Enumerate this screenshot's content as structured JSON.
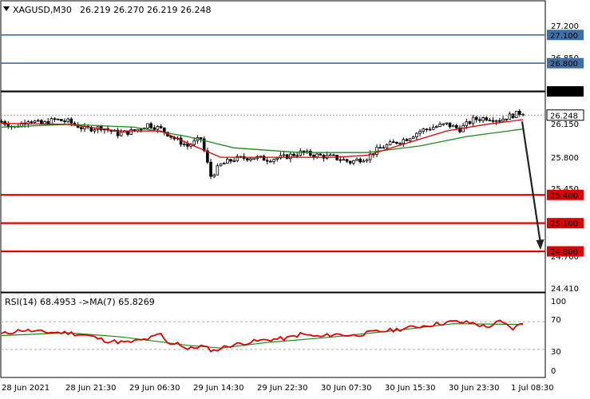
{
  "header": {
    "symbol": "XAGUSD,M30",
    "ohlc": "26.219 26.270 26.219 26.248"
  },
  "price_axis": {
    "ticks": [
      "27.200",
      "26.850",
      "26.150",
      "25.800",
      "25.450",
      "24.700",
      "24.410"
    ],
    "current_price": "26.248"
  },
  "levels": [
    {
      "label": "27.100",
      "value": 27.1,
      "color": "#3d6fa8",
      "box": "#3d6fa8",
      "text": "#ffffff",
      "width": 1.6
    },
    {
      "label": "26.800",
      "value": 26.8,
      "color": "#3d6fa8",
      "box": "#3d6fa8",
      "text": "#ffffff",
      "width": 1.6
    },
    {
      "label": "26.500",
      "value": 26.5,
      "color": "#000000",
      "box": "#000000",
      "text": "#ffffff",
      "width": 2.2
    },
    {
      "label": "25.400",
      "value": 25.4,
      "color": "#e00000",
      "box": "#e00000",
      "text": "#ffffff",
      "width": 2.2
    },
    {
      "label": "25.100",
      "value": 25.1,
      "color": "#e00000",
      "box": "#e00000",
      "text": "#ffffff",
      "width": 2.2
    },
    {
      "label": "24.800",
      "value": 24.8,
      "color": "#e00000",
      "box": "#e00000",
      "text": "#ffffff",
      "width": 2.2
    }
  ],
  "rsi": {
    "label": "RSI(14) 68.4953 ->MA(7) 65.8269",
    "ticks": [
      "100",
      "70",
      "30",
      "0"
    ]
  },
  "time_axis": {
    "labels": [
      "28 Jun 2021",
      "28 Jun 21:30",
      "29 Jun 06:30",
      "29 Jun 14:30",
      "29 Jun 22:30",
      "30 Jun 07:30",
      "30 Jun 15:30",
      "30 Jun 23:30",
      "1 Jul 08:30"
    ]
  },
  "colors": {
    "ma_fast": "#e00000",
    "ma_slow": "#1a8a1a",
    "rsi_line": "#e00000",
    "rsi_ma": "#1a8a1a",
    "arrow": "#222222"
  },
  "chart_data": {
    "type": "candlestick",
    "price_range": [
      24.41,
      27.3
    ],
    "close_path": [
      [
        0,
        26.18
      ],
      [
        4,
        26.12
      ],
      [
        8,
        26.2
      ],
      [
        12,
        26.15
      ],
      [
        16,
        26.2
      ],
      [
        20,
        26.18
      ],
      [
        25,
        26.1
      ],
      [
        30,
        26.12
      ],
      [
        35,
        26.05
      ],
      [
        40,
        26.08
      ],
      [
        44,
        26.15
      ],
      [
        48,
        26.1
      ],
      [
        52,
        26.0
      ],
      [
        56,
        25.92
      ],
      [
        60,
        26.0
      ],
      [
        63,
        25.6
      ],
      [
        66,
        25.72
      ],
      [
        70,
        25.78
      ],
      [
        75,
        25.8
      ],
      [
        80,
        25.78
      ],
      [
        85,
        25.8
      ],
      [
        90,
        25.85
      ],
      [
        95,
        25.82
      ],
      [
        100,
        25.8
      ],
      [
        105,
        25.75
      ],
      [
        110,
        25.8
      ],
      [
        114,
        25.9
      ],
      [
        118,
        25.95
      ],
      [
        122,
        26.0
      ],
      [
        126,
        26.08
      ],
      [
        130,
        26.12
      ],
      [
        134,
        26.15
      ],
      [
        138,
        26.1
      ],
      [
        142,
        26.2
      ],
      [
        146,
        26.22
      ],
      [
        150,
        26.2
      ],
      [
        154,
        26.25
      ],
      [
        157,
        26.28
      ]
    ],
    "ma_fast": [
      [
        0,
        26.16
      ],
      [
        20,
        26.15
      ],
      [
        35,
        26.08
      ],
      [
        48,
        26.08
      ],
      [
        56,
        25.95
      ],
      [
        66,
        25.8
      ],
      [
        80,
        25.8
      ],
      [
        100,
        25.8
      ],
      [
        110,
        25.82
      ],
      [
        122,
        25.95
      ],
      [
        134,
        26.08
      ],
      [
        146,
        26.15
      ],
      [
        157,
        26.2
      ]
    ],
    "ma_slow": [
      [
        0,
        26.12
      ],
      [
        20,
        26.15
      ],
      [
        40,
        26.12
      ],
      [
        56,
        26.02
      ],
      [
        70,
        25.9
      ],
      [
        90,
        25.85
      ],
      [
        110,
        25.85
      ],
      [
        126,
        25.92
      ],
      [
        140,
        26.02
      ],
      [
        157,
        26.1
      ]
    ],
    "rsi_close": [
      [
        0,
        52
      ],
      [
        6,
        58
      ],
      [
        12,
        55
      ],
      [
        20,
        54
      ],
      [
        26,
        50
      ],
      [
        32,
        42
      ],
      [
        38,
        40
      ],
      [
        44,
        45
      ],
      [
        48,
        52
      ],
      [
        50,
        38
      ],
      [
        53,
        40
      ],
      [
        56,
        30
      ],
      [
        60,
        35
      ],
      [
        64,
        28
      ],
      [
        68,
        35
      ],
      [
        74,
        40
      ],
      [
        80,
        44
      ],
      [
        86,
        46
      ],
      [
        90,
        52
      ],
      [
        96,
        48
      ],
      [
        100,
        52
      ],
      [
        106,
        50
      ],
      [
        112,
        55
      ],
      [
        118,
        58
      ],
      [
        124,
        62
      ],
      [
        130,
        66
      ],
      [
        136,
        70
      ],
      [
        142,
        68
      ],
      [
        146,
        62
      ],
      [
        150,
        70
      ],
      [
        154,
        60
      ],
      [
        157,
        68
      ]
    ],
    "rsi_ma": [
      [
        0,
        50
      ],
      [
        20,
        54
      ],
      [
        36,
        48
      ],
      [
        56,
        36
      ],
      [
        66,
        32
      ],
      [
        80,
        40
      ],
      [
        100,
        48
      ],
      [
        120,
        58
      ],
      [
        136,
        67
      ],
      [
        157,
        66
      ]
    ],
    "rsi_range": [
      0,
      100
    ],
    "projection_to": 24.8
  }
}
